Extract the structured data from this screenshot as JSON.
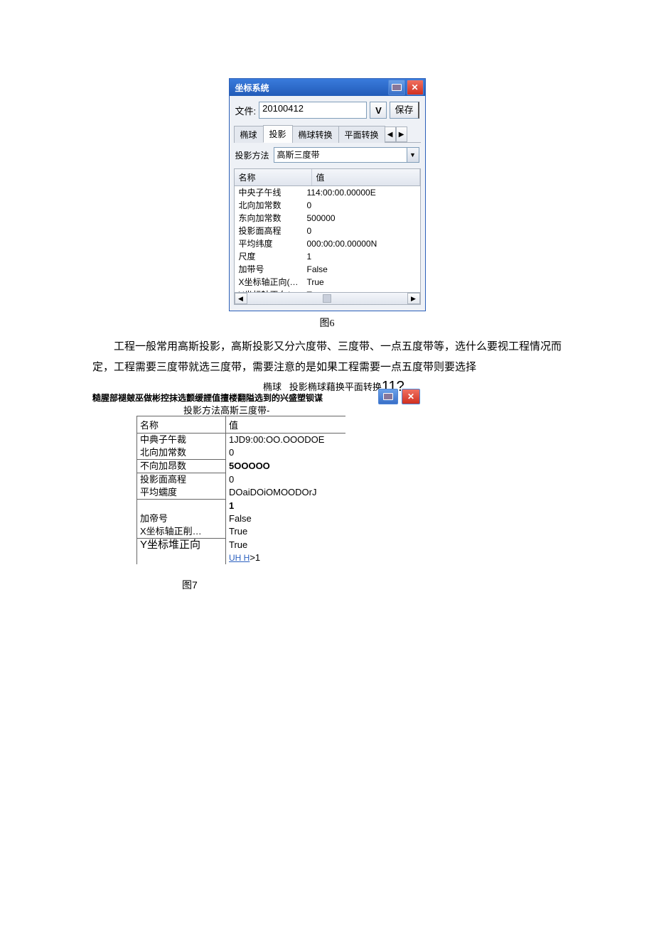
{
  "dlg1": {
    "title": "坐标系统",
    "file_label": "文件:",
    "file_value": "20100412",
    "v_btn": "V",
    "save": "保存",
    "tabs": [
      "椭球",
      "投影",
      "椭球转换",
      "平面转换"
    ],
    "proj_label": "投影方法",
    "proj_value": "高斯三度带",
    "col_name": "名称",
    "col_value": "值",
    "rows": [
      {
        "n": "中央子午线",
        "v": "114:00:00.00000E"
      },
      {
        "n": "北向加常数",
        "v": "0"
      },
      {
        "n": "东向加常数",
        "v": "500000"
      },
      {
        "n": "投影面高程",
        "v": "0"
      },
      {
        "n": "平均纬度",
        "v": "000:00:00.00000N"
      },
      {
        "n": "尺度",
        "v": "1"
      },
      {
        "n": "加带号",
        "v": "False"
      },
      {
        "n": "X坐标轴正向(…",
        "v": "True"
      },
      {
        "n": "Y坐标轴正向(…",
        "v": "True"
      }
    ]
  },
  "cap6": "图6",
  "para1": "工程一般常用高斯投影，高斯投影又分六度带、三度带、一点五度带等，选什么要视工程情况而定，工程需要三度带就选三度带，需要注意的是如果工程需要一点五度带则要选择",
  "dlg2": {
    "tabline_a": "椭球",
    "tabline_b": "投影椭球藉换平面转换",
    "tabline_big": "11?",
    "garble": "糙腥部褪皴巫做彬控抹选颤缓諲值擅楼翻隘选到的兴盛塑钡谋",
    "projline": "投影方法高斯三度带-",
    "col_name": "名称",
    "col_value": "值",
    "rows": [
      {
        "n": "中典子午裁",
        "u": false,
        "v": "1JD9:00:OO.OOODOE"
      },
      {
        "n": "北向加常数",
        "u": true,
        "v": "0"
      },
      {
        "n": "不向加昂数",
        "u": true,
        "v": "5OOOOO"
      },
      {
        "n": "投影面高程",
        "u": false,
        "v": "0"
      },
      {
        "n": "平均蠕度",
        "u": true,
        "v": "DOaiDOiOMOODOrJ"
      },
      {
        "n": "",
        "u": false,
        "v": "1"
      },
      {
        "n": "加帝号",
        "u": false,
        "v": "False"
      },
      {
        "n": "X坐标轴正削…",
        "u": true,
        "v": "True"
      },
      {
        "n": "Y坐标堆正向",
        "u": false,
        "v": "True"
      }
    ],
    "link": "UH  H",
    "link_after": ">1"
  },
  "cap7": "图7"
}
